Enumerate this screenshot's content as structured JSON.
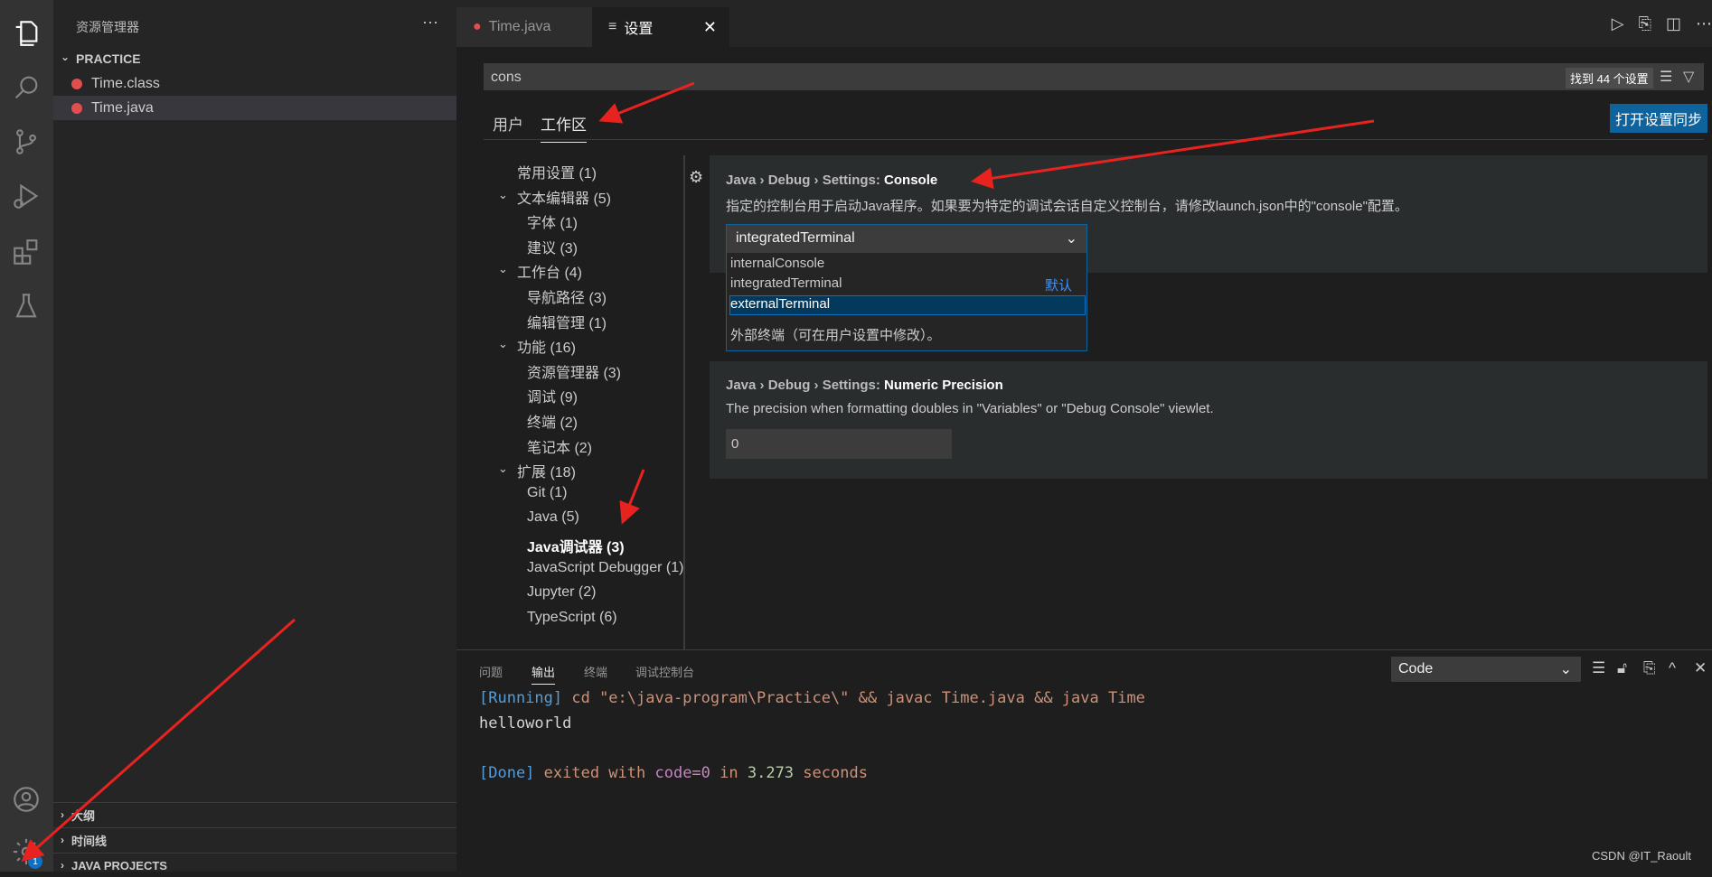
{
  "sidebar": {
    "header": "资源管理器",
    "more": "···",
    "folder": "PRACTICE",
    "files": [
      "Time.class",
      "Time.java"
    ],
    "sections": [
      "大纲",
      "时间线",
      "JAVA PROJECTS"
    ]
  },
  "activity": {
    "badge": "1"
  },
  "tabs": {
    "time": "Time.java",
    "settings": "设置",
    "close": "✕"
  },
  "search": {
    "value": "cons",
    "count": "找到 44 个设置"
  },
  "scope": {
    "user": "用户",
    "workspace": "工作区",
    "sync": "打开设置同步"
  },
  "toc": [
    "常用设置 (1)",
    "文本编辑器 (5)",
    "字体 (1)",
    "建议 (3)",
    "工作台 (4)",
    "导航路径 (3)",
    "编辑管理 (1)",
    "功能 (16)",
    "资源管理器 (3)",
    "调试 (9)",
    "终端 (2)",
    "笔记本 (2)",
    "扩展 (18)",
    "Git (1)",
    "Java (5)",
    "Java调试器 (3)",
    "JavaScript Debugger (1)",
    "Jupyter (2)",
    "TypeScript (6)"
  ],
  "settings": {
    "console": {
      "category": "Java › Debug › Settings: ",
      "name": "Console",
      "desc": "指定的控制台用于启动Java程序。如果要为特定的调试会话自定义控制台，请修改launch.json中的\"console\"配置。",
      "value": "integratedTerminal",
      "options": [
        "internalConsole",
        "integratedTerminal",
        "externalTerminal"
      ],
      "default_label": "默认",
      "option_desc": "外部终端（可在用户设置中修改）。"
    },
    "precision": {
      "category": "Java › Debug › Settings: ",
      "name": "Numeric Precision",
      "desc": "The precision when formatting doubles in \"Variables\" or \"Debug Console\" viewlet.",
      "value": "0"
    }
  },
  "panel": {
    "tabs": [
      "问题",
      "输出",
      "终端",
      "调试控制台"
    ],
    "channel": "Code",
    "lines": {
      "running_tag": "[Running]",
      "running_cmd": " cd \"e:\\java-program\\Practice\\\" && javac Time.java && java Time",
      "output": "helloworld",
      "done_tag": "[Done]",
      "done_1": " exited with ",
      "done_code": "code=0",
      "done_2": " in ",
      "done_secs": "3.273",
      "done_3": " seconds"
    }
  },
  "watermark": "CSDN @IT_Raoult"
}
